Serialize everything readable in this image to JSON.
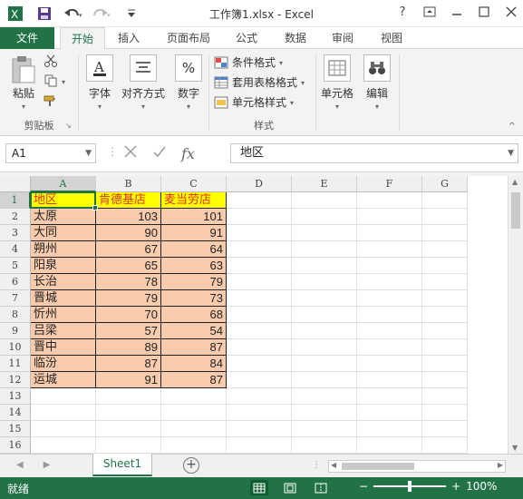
{
  "window": {
    "title": "工作簿1.xlsx - Excel"
  },
  "tabs": [
    "文件",
    "开始",
    "插入",
    "页面布局",
    "公式",
    "数据",
    "审阅",
    "视图"
  ],
  "ribbon": {
    "clipboard": {
      "paste": "粘贴",
      "group": "剪贴板"
    },
    "font": "字体",
    "alignment": "对齐方式",
    "number": "数字",
    "number_icon": "%",
    "styles": {
      "conditional": "条件格式",
      "table": "套用表格格式",
      "cell": "单元格样式",
      "group": "样式"
    },
    "cells": "单元格",
    "editing": "编辑"
  },
  "formula_bar": {
    "name_box": "A1",
    "content": "地区",
    "fx": "fx"
  },
  "sheet": {
    "columns": [
      "A",
      "B",
      "C",
      "D",
      "E",
      "F",
      "G"
    ],
    "rows": [
      "1",
      "2",
      "3",
      "4",
      "5",
      "6",
      "7",
      "8",
      "9",
      "10",
      "11",
      "12",
      "13",
      "14",
      "15",
      "16"
    ],
    "headers": [
      "地区",
      "肯德基店",
      "麦当劳店"
    ],
    "data": [
      [
        "太原",
        "103",
        "101"
      ],
      [
        "大同",
        "90",
        "91"
      ],
      [
        "朔州",
        "67",
        "64"
      ],
      [
        "阳泉",
        "65",
        "63"
      ],
      [
        "长治",
        "78",
        "79"
      ],
      [
        "晋城",
        "79",
        "73"
      ],
      [
        "忻州",
        "70",
        "68"
      ],
      [
        "吕梁",
        "57",
        "54"
      ],
      [
        "晋中",
        "89",
        "87"
      ],
      [
        "临汾",
        "87",
        "84"
      ],
      [
        "运城",
        "91",
        "87"
      ]
    ]
  },
  "sheet_tabs": {
    "active": "Sheet1",
    "add": "+"
  },
  "status": {
    "ready": "就绪",
    "zoom": "100%"
  },
  "colors": {
    "accent": "#217346",
    "header_fill": "#ffff00",
    "header_text": "#e0301e",
    "data_fill": "#f8cbad"
  }
}
